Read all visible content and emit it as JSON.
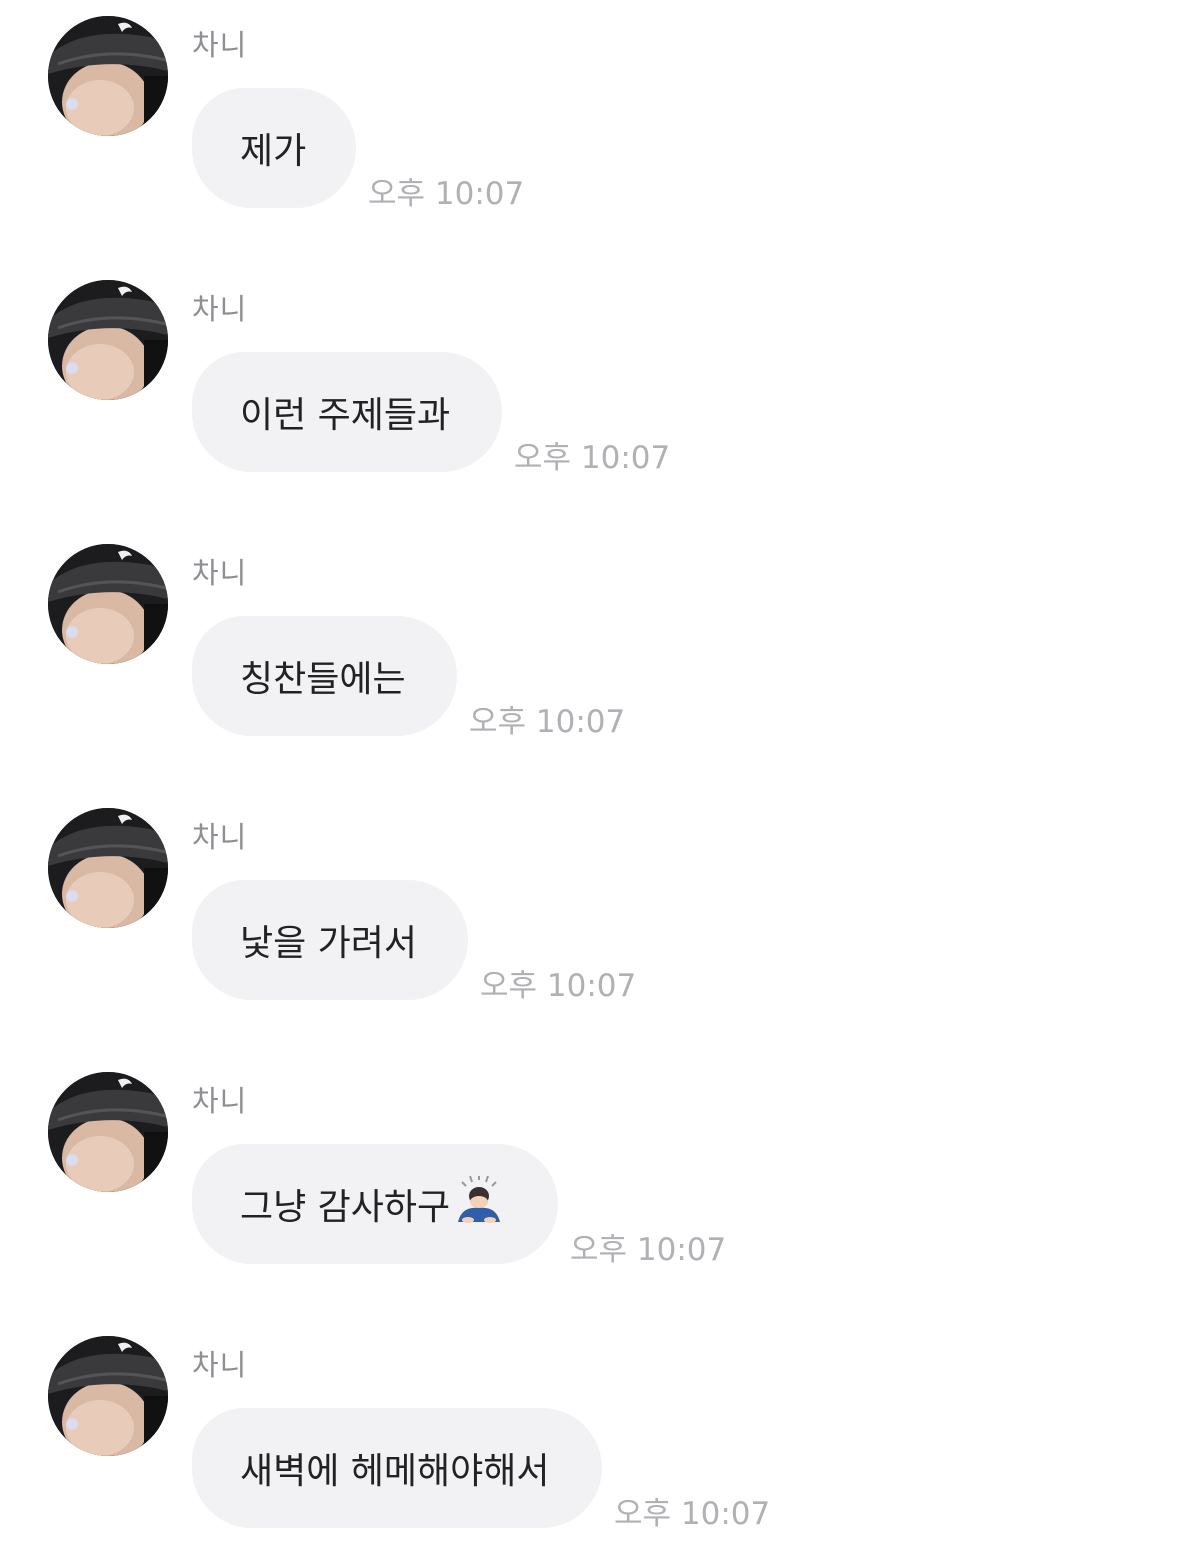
{
  "sender_name": "차니",
  "avatar_icon": "profile-photo-avatar",
  "messages": [
    {
      "text": "제가",
      "time": "오후 10:07"
    },
    {
      "text": "이런 주제들과",
      "time": "오후 10:07"
    },
    {
      "text": "칭찬들에는",
      "time": "오후 10:07"
    },
    {
      "text": "낯을 가려서",
      "time": "오후 10:07"
    },
    {
      "text": "그냥 감사하구",
      "emoji": "bowing-person-emoji",
      "time": "오후 10:07"
    },
    {
      "text": "새벽에 헤메해야해서",
      "time": "오후 10:07"
    }
  ],
  "colors": {
    "bubble_bg": "#f2f2f5",
    "message_text": "#222222",
    "sender_text": "#8e8e93",
    "time_text": "#b0b0b5"
  }
}
